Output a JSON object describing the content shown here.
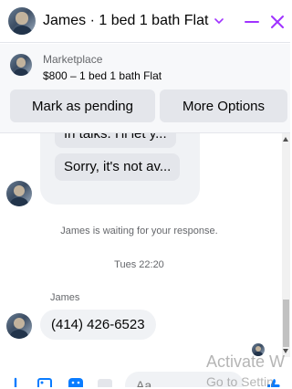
{
  "header": {
    "title": "James · 1 bed 1 bath Flat",
    "accent_color": "#a033ff",
    "icons": [
      "avatar",
      "chevron-down-icon",
      "minimize-icon",
      "close-icon"
    ]
  },
  "marketplace": {
    "label": "Marketplace",
    "item": "$800 – 1 bed 1 bath Flat",
    "buttons": {
      "pending": "Mark as pending",
      "more": "More Options"
    }
  },
  "messages": {
    "outgoing_previews": [
      "In talks. I'll let y...",
      "Sorry, it's not av..."
    ],
    "waiting_notice": "James is waiting for your response.",
    "timestamp": "Tues 22:20",
    "sender": "James",
    "last_message": "(414) 426-6523"
  },
  "composer": {
    "placeholder": "Aa",
    "icons": [
      "add-icon",
      "photo-icon",
      "sticker-icon",
      "gif-icon",
      "like-icon"
    ]
  },
  "watermark": {
    "line1": "Activate W",
    "line2": "Go to Settin"
  }
}
